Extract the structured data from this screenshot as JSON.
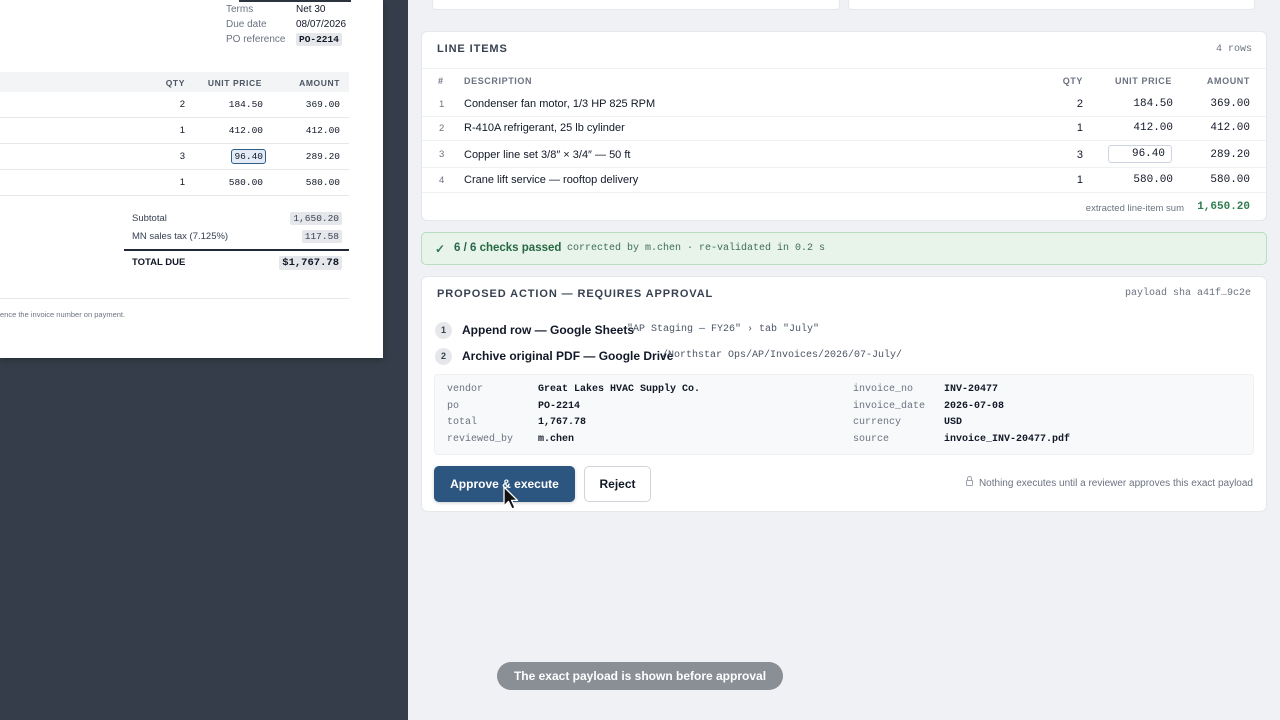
{
  "invoice_doc": {
    "meta": [
      {
        "label": "Terms",
        "value": "Net 30"
      },
      {
        "label": "Due date",
        "value": "08/07/2026"
      },
      {
        "label": "PO reference",
        "value": "PO-2214"
      }
    ],
    "headers": {
      "qty": "QTY",
      "unit_price": "UNIT PRICE",
      "amount": "AMOUNT"
    },
    "rows": [
      {
        "qty": "2",
        "unit_price": "184.50",
        "amount": "369.00"
      },
      {
        "qty": "1",
        "unit_price": "412.00",
        "amount": "412.00"
      },
      {
        "qty": "3",
        "unit_price": "96.40",
        "amount": "289.20"
      },
      {
        "qty": "1",
        "unit_price": "580.00",
        "amount": "580.00"
      }
    ],
    "subtotal_label": "Subtotal",
    "subtotal_value": "1,650.20",
    "tax_label": "MN sales tax (7.125%)",
    "tax_value": "117.58",
    "total_label": "TOTAL DUE",
    "total_value": "$1,767.78",
    "footer": "ence the invoice number on payment."
  },
  "line_items": {
    "title": "LINE ITEMS",
    "rows_count": "4 rows",
    "headers": {
      "num": "#",
      "description": "DESCRIPTION",
      "qty": "QTY",
      "unit_price": "UNIT PRICE",
      "amount": "AMOUNT"
    },
    "rows": [
      {
        "num": "1",
        "description": "Condenser fan motor, 1/3 HP 825 RPM",
        "qty": "2",
        "unit_price": "184.50",
        "amount": "369.00"
      },
      {
        "num": "2",
        "description": "R-410A refrigerant, 25 lb cylinder",
        "qty": "1",
        "unit_price": "412.00",
        "amount": "412.00"
      },
      {
        "num": "3",
        "description": "Copper line set 3/8″ × 3/4″ — 50 ft",
        "qty": "3",
        "unit_price": "96.40",
        "amount": "289.20"
      },
      {
        "num": "4",
        "description": "Crane lift service — rooftop delivery",
        "qty": "1",
        "unit_price": "580.00",
        "amount": "580.00"
      }
    ],
    "sum_label": "extracted line-item sum",
    "sum_value": "1,650.20"
  },
  "checks": {
    "passed": "6 / 6 checks passed",
    "note": "corrected by m.chen · re-validated in 0.2 s",
    "accent_color": "#2e7d4f"
  },
  "action": {
    "title": "PROPOSED ACTION — REQUIRES APPROVAL",
    "sha": "payload sha a41f…9c2e",
    "steps": [
      {
        "n": "1",
        "label": "Append row — Google Sheets",
        "detail": "\"AP Staging — FY26\" › tab \"July\""
      },
      {
        "n": "2",
        "label": "Archive original PDF — Google Drive",
        "detail": "/Northstar Ops/AP/Invoices/2026/07-July/"
      }
    ],
    "payload": {
      "vendor_k": "vendor",
      "vendor_v": "Great Lakes HVAC Supply Co.",
      "po_k": "po",
      "po_v": "PO-2214",
      "total_k": "total",
      "total_v": "1,767.78",
      "reviewed_k": "reviewed_by",
      "reviewed_v": "m.chen",
      "invno_k": "invoice_no",
      "invno_v": "INV-20477",
      "invdate_k": "invoice_date",
      "invdate_v": "2026-07-08",
      "currency_k": "currency",
      "currency_v": "USD",
      "source_k": "source",
      "source_v": "invoice_INV-20477.pdf"
    },
    "approve_label": "Approve & execute",
    "reject_label": "Reject",
    "notice": "Nothing executes until a reviewer approves this exact payload",
    "approve_color": "#2c5580"
  },
  "toast": "The exact payload is shown before approval"
}
